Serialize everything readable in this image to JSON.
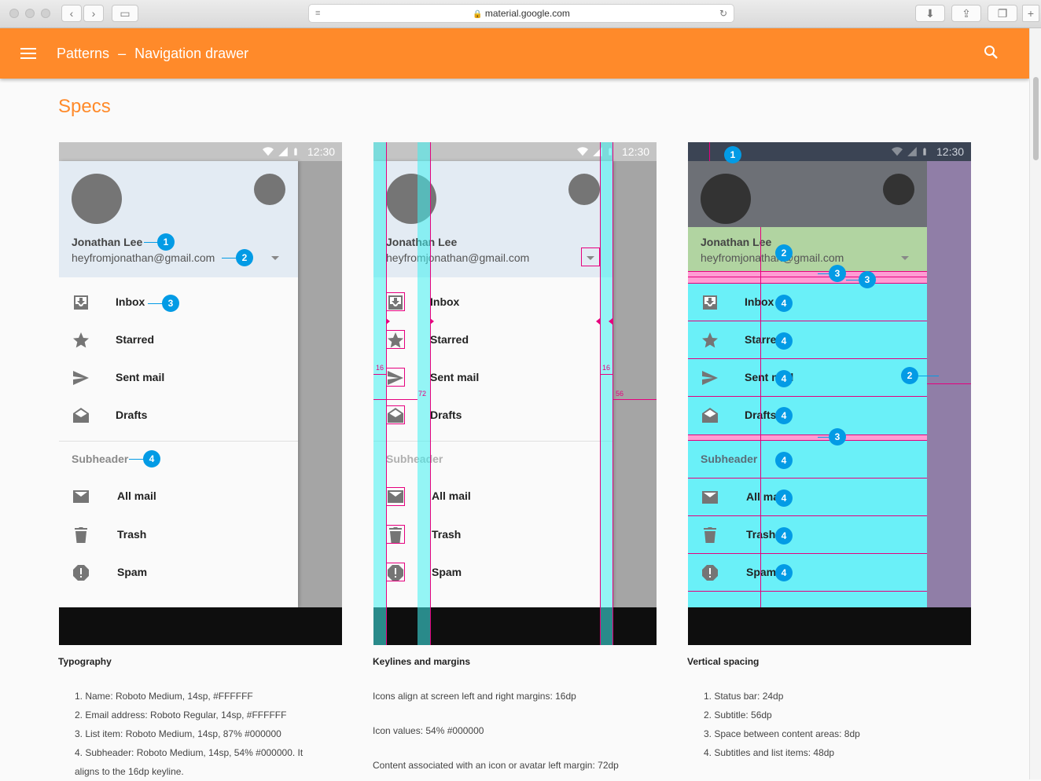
{
  "browser": {
    "url": "material.google.com"
  },
  "appbar": {
    "title": "Patterns",
    "separator": "–",
    "subtitle": "Navigation drawer",
    "menu_icon": "menu-icon",
    "search_icon": "search-icon"
  },
  "page": {
    "heading": "Specs"
  },
  "phone": {
    "time": "12:30",
    "account_name": "Jonathan Lee",
    "account_email": "heyfromjonathan@gmail.com",
    "items": [
      {
        "label": "Inbox",
        "icon": "inbox-icon"
      },
      {
        "label": "Starred",
        "icon": "star-icon"
      },
      {
        "label": "Sent mail",
        "icon": "send-icon"
      },
      {
        "label": "Drafts",
        "icon": "drafts-icon"
      }
    ],
    "subheader": "Subheader",
    "items2": [
      {
        "label": "All mail",
        "icon": "mail-icon"
      },
      {
        "label": "Trash",
        "icon": "trash-icon"
      },
      {
        "label": "Spam",
        "icon": "spam-icon"
      }
    ]
  },
  "keyline_labels": {
    "left_margin": "16",
    "right_margin": "16",
    "content_keyline": "72",
    "drawer_gap": "56"
  },
  "typography": {
    "caption": "Typography",
    "notes": [
      "1. Name: Roboto Medium, 14sp, #FFFFFF",
      "2. Email address: Roboto Regular, 14sp, #FFFFFF",
      "3. List item: Roboto Medium, 14sp, 87% #000000",
      "4. Subheader: Roboto Medium, 14sp, 54% #000000. It aligns to the 16dp keyline."
    ]
  },
  "keylines": {
    "caption": "Keylines and margins",
    "notes": [
      "Icons align at screen left and right margins: 16dp",
      "Icon values: 54% #000000",
      "Content associated with an icon or avatar left margin: 72dp"
    ]
  },
  "spacing": {
    "caption": "Vertical spacing",
    "notes": [
      "1. Status bar: 24dp",
      "2. Subtitle: 56dp",
      "3. Space between content areas: 8dp",
      "4. Subtitles and list items: 48dp"
    ]
  },
  "colors": {
    "appbar": "#ff8a2a",
    "badge": "#039be5",
    "keyline": "#e6007e",
    "cyan": "#6af0f8"
  }
}
